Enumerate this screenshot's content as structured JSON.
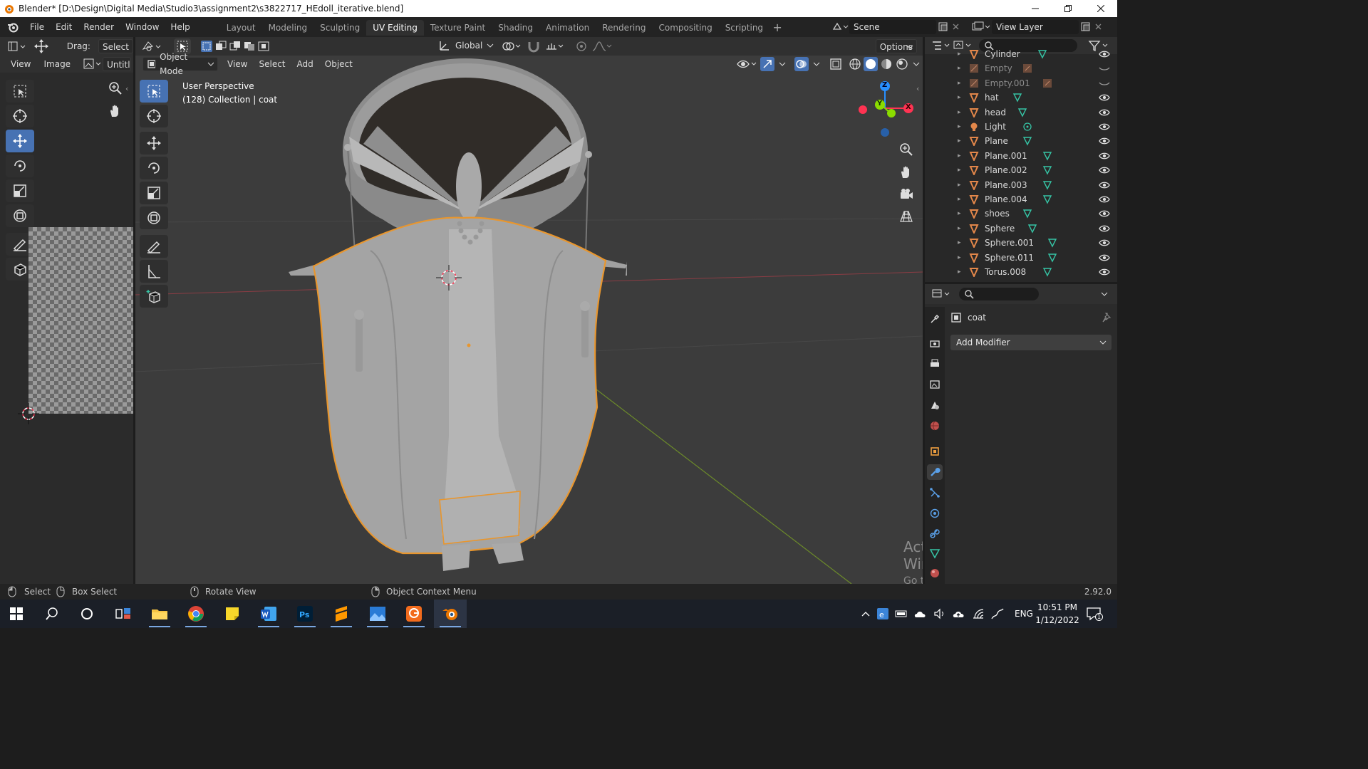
{
  "window": {
    "title": "Blender* [D:\\Design\\Digital Media\\Studio3\\assignment2\\s3822717_HEdoll_iterative.blend]"
  },
  "menu": [
    "File",
    "Edit",
    "Render",
    "Window",
    "Help"
  ],
  "workspaces": {
    "tabs": [
      "Layout",
      "Modeling",
      "Sculpting",
      "UV Editing",
      "Texture Paint",
      "Shading",
      "Animation",
      "Rendering",
      "Compositing",
      "Scripting"
    ],
    "active": "UV Editing"
  },
  "scene": {
    "name": "Scene",
    "view_layer": "View Layer"
  },
  "uv_editor": {
    "drag_label": "Drag:",
    "drag_value": "Select",
    "menus": [
      "View",
      "Image"
    ],
    "image_name": "Untitle"
  },
  "viewport": {
    "transform_orientation": "Global",
    "options_label": "Options",
    "mode": "Object Mode",
    "menus": [
      "View",
      "Select",
      "Add",
      "Object"
    ],
    "overlay_line1": "User Perspective",
    "overlay_line2": "(128) Collection | coat",
    "gizmo_labels": {
      "x": "X",
      "y": "Y",
      "z": "Z"
    },
    "watermark_title": "Activate Windows",
    "watermark_sub": "Go to Settings to activate Windows."
  },
  "outliner": {
    "rows": [
      {
        "name": "Cylinder",
        "type": "mesh",
        "visible": true,
        "dim": false
      },
      {
        "name": "Empty",
        "type": "empty",
        "visible": false,
        "dim": true
      },
      {
        "name": "Empty.001",
        "type": "empty",
        "visible": false,
        "dim": true
      },
      {
        "name": "hat",
        "type": "mesh",
        "visible": true,
        "dim": false
      },
      {
        "name": "head",
        "type": "mesh",
        "visible": true,
        "dim": false
      },
      {
        "name": "Light",
        "type": "light",
        "visible": true,
        "dim": false
      },
      {
        "name": "Plane",
        "type": "mesh",
        "visible": true,
        "dim": false
      },
      {
        "name": "Plane.001",
        "type": "mesh",
        "visible": true,
        "dim": false
      },
      {
        "name": "Plane.002",
        "type": "mesh",
        "visible": true,
        "dim": false
      },
      {
        "name": "Plane.003",
        "type": "mesh",
        "visible": true,
        "dim": false
      },
      {
        "name": "Plane.004",
        "type": "mesh",
        "visible": true,
        "dim": false
      },
      {
        "name": "shoes",
        "type": "mesh",
        "visible": true,
        "dim": false
      },
      {
        "name": "Sphere",
        "type": "mesh",
        "visible": true,
        "dim": false
      },
      {
        "name": "Sphere.001",
        "type": "mesh",
        "visible": true,
        "dim": false
      },
      {
        "name": "Sphere.011",
        "type": "mesh",
        "visible": true,
        "dim": false
      },
      {
        "name": "Torus.008",
        "type": "mesh",
        "visible": true,
        "dim": false
      }
    ]
  },
  "properties": {
    "object_name": "coat",
    "add_modifier_label": "Add Modifier"
  },
  "statusbar": {
    "select": "Select",
    "box_select": "Box Select",
    "rotate_view": "Rotate View",
    "context_menu": "Object Context Menu",
    "version": "2.92.0"
  },
  "taskbar": {
    "language": "ENG",
    "time": "10:51 PM",
    "date": "1/12/2022",
    "notification_count": "1"
  },
  "colors": {
    "selection_outline": "#e8962e",
    "active_button": "#4772b3",
    "mesh_icon": "#e3874a",
    "data_icon": "#36c4a5",
    "x_axis": "#ff3352",
    "y_axis": "#8bdc00",
    "z_axis": "#2890ff"
  }
}
